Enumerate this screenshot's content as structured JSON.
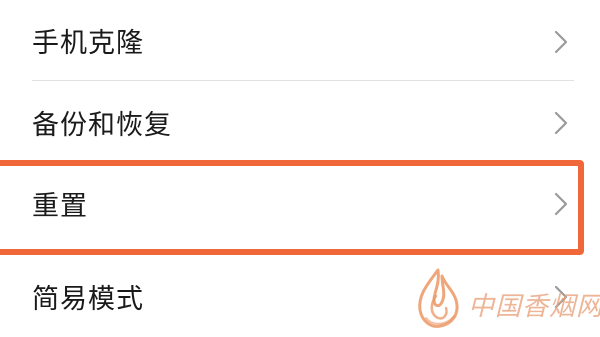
{
  "settings": {
    "items": [
      {
        "label": "手机克隆",
        "icon": "chevron-right-icon"
      },
      {
        "label": "备份和恢复",
        "icon": "chevron-right-icon"
      },
      {
        "label": "重置",
        "icon": "chevron-right-icon",
        "highlighted": true
      },
      {
        "label": "简易模式",
        "icon": "chevron-right-icon"
      }
    ]
  },
  "annotation": {
    "highlight_color": "#f0683a"
  },
  "watermark": {
    "text": "中国香烟网",
    "logo_icon": "flame-logo-icon",
    "color": "#e8a078"
  },
  "colors": {
    "text": "#1a1a1a",
    "chevron": "#9a9a9a",
    "divider": "#e2e2e2",
    "background": "#ffffff"
  }
}
